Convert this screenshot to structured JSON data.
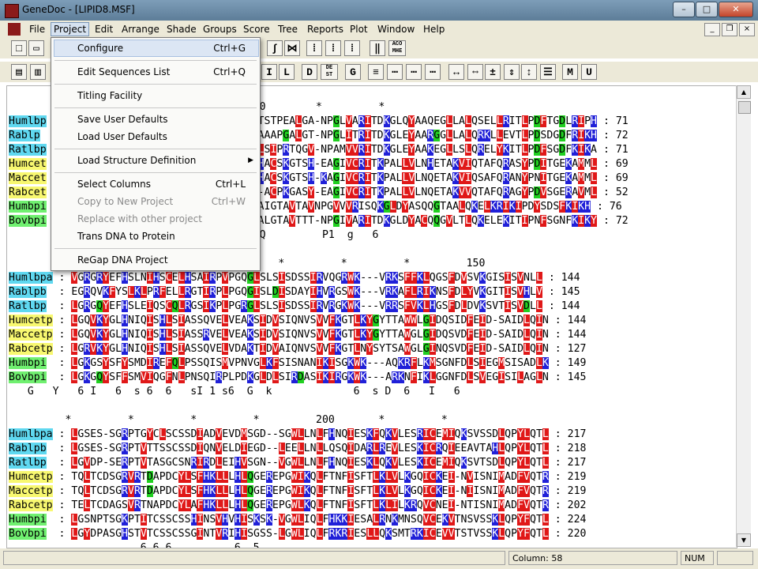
{
  "window": {
    "title": "GeneDoc - [LIPID8.MSF]",
    "min_glyph": "–",
    "max_glyph": "□",
    "close_glyph": "✕"
  },
  "menu": {
    "items": [
      "File",
      "Project",
      "Edit",
      "Arrange",
      "Shade",
      "Groups",
      "Score",
      "Tree",
      "Reports",
      "Plot",
      "Window",
      "Help"
    ],
    "active": "Project"
  },
  "project_menu": {
    "items": [
      {
        "label": "Configure",
        "shortcut": "Ctrl+G",
        "disabled": false,
        "highlighted": true
      },
      {
        "label": "Edit Sequences List",
        "shortcut": "Ctrl+Q",
        "disabled": false
      },
      {
        "label": "Titling Facility",
        "shortcut": "",
        "disabled": false
      },
      {
        "label": "Save User Defaults",
        "shortcut": "",
        "disabled": false
      },
      {
        "label": "Load  User Defaults",
        "shortcut": "",
        "disabled": false
      },
      {
        "label": "Load Structure Definition",
        "shortcut": "",
        "disabled": false,
        "submenu": true
      },
      {
        "label": "Select Columns",
        "shortcut": "Ctrl+L",
        "disabled": false
      },
      {
        "label": "Copy to New Project",
        "shortcut": "Ctrl+W",
        "disabled": true
      },
      {
        "label": "Replace with other project",
        "shortcut": "",
        "disabled": true
      },
      {
        "label": "Trans DNA to Protein",
        "shortcut": "",
        "disabled": false
      },
      {
        "label": "ReGap DNA Project",
        "shortcut": "",
        "disabled": false
      }
    ]
  },
  "toolbar2_labels": [
    "I",
    "L",
    "D",
    "G",
    "M",
    "U"
  ],
  "toolbar2_small": [
    "DE ST"
  ],
  "toolbar1_small": [
    "ACO MHE"
  ],
  "alignment": {
    "block1": {
      "ruler": "                   *         *         50        *         *",
      "rows": [
        {
          "name": "Humlbp",
          "tail": "TSTPEALGA-NPGLVARITDKGLQYAAQEGLLALQSELLRITLPDFTGDLRIPH",
          "pos": "71"
        },
        {
          "name": "Rablp",
          "tail": "AAAPGALGT-NPGLITRITDKGLEYAARGGLLALQRKLLEVTLPDSDGDFRIKH",
          "pos": "72"
        },
        {
          "name": "Ratlbp",
          "tail": "LSIPRTQGV-NPAMVVRITDKGLEYAAKEGLLSLQRELYKITLPDFSGDFKIKA",
          "pos": "71"
        },
        {
          "name": "Humcet",
          "tail": "HACSKGTSH-EAGIVCRITKPALLVLNHETAKVIQTAFQRASYPDITGEKAMML",
          "pos": "69"
        },
        {
          "name": "Maccet",
          "tail": "HACSKGTSH-KAGIVCRITKPALLVLNQETAKVIQSAFQRANYPNITGEKAMML",
          "pos": "69"
        },
        {
          "name": "Rabcet",
          "tail": "-ACPKGASY-EAGIVCRITKPALLVLNQETAKVVQTAFQRAGYPDVSGERAVML",
          "pos": "52"
        },
        {
          "name": "Humbpi",
          "tail": "AIGTAVTAVNPGVVVRISQKGLDYASQQGTAALQKELKRIKIPDYSDSFKIKH",
          "pos": "76"
        },
        {
          "name": "Bovbpi",
          "tail": "ALGTAVTTT-NPGIVARITDKGLDYACQQGVLTLQKELEKITIPNFSGNFKIKY",
          "pos": "72"
        }
      ],
      "consensus": "                   g66 RI3   L    2    6Q         P1  g   6"
    },
    "block2": {
      "ruler": "                      00         *         *         *         *         150",
      "rows": [
        {
          "name": "Humlbpa",
          "seq": "VGRGRYEFHSLNIHSCELHSAIRPVPGQGLSLSISDSSIRVQGRWK---VRKSFFKLQGSFDVSVKGISISVNLL",
          "pos": "144"
        },
        {
          "name": "Rablpb",
          "seq": "EGRQVKFYSLKLPRFELLRGTIRPLPGQGISLDISDAYIHVRGSWK---VRKAFLRIKNSFDLYVKGITISVHLV",
          "pos": "145"
        },
        {
          "name": "Ratlbp",
          "seq": "LGRGQYEFHSLEIQSCQLRGSIKPLPGRGLSLSISDSSIRVRGKWK---VRRSFVKLHGSFDLDVKSVTISVDLL",
          "pos": "144"
        },
        {
          "name": "Humcetp",
          "seq": "LGQVKYGLHNIQISHLSIASSQVELVEAKSIDVSIQNVSVVFKGTLKYGYTTAWWLGIDQSIDFEID-SAIDLQIN",
          "pos": "144"
        },
        {
          "name": "Maccetp",
          "seq": "LGQVKYGLHNIQISHLSIASSRVELVEAKSIDVSIQNVSVVFKGTLKYGYTTAWGLGIDQSVDFEID-SAIDLQIN",
          "pos": "144"
        },
        {
          "name": "Rabcetp",
          "seq": "LGRVKYGLHNIQISHLSIASSQVELVDAKTIDVAIQNVSVVFKGTLNYSYTSAWGLGINQSVDFEID-SAIDLQIN",
          "pos": "127"
        },
        {
          "name": "Humbpi",
          "seq": "LGKGSYSFYSMDIREFQLPSSQISMVPNVGLKFSISNANIKISGKWK---AQKRFLKMSGNFDLSIEGMSISADLK",
          "pos": "149"
        },
        {
          "name": "Bovbpi",
          "seq": "LGKGQYSFFSMVIQGFNLPNSQIRPLPDKGLDLSIRDASIKIRGKWK---ARKNFIKLGGNFDLSVEGISILAGLN",
          "pos": "145"
        }
      ],
      "consensus": "   G   Y   6 I   6  s 6  6   sI 1 s6  G  k             6  s D  6   I   6"
    },
    "block3": {
      "ruler": "         *         *         *         *         200       *         *",
      "rows": [
        {
          "name": "Humlbpa",
          "seq": "LGSES-SGRPTGYCLSCSSDIADVEVDMSGD--SGWLLNLFHNQIESKFQKVLESRICEMIQKSVSSDLQPYLQTL",
          "pos": "217"
        },
        {
          "name": "Rablpb",
          "seq": "LGSES-SGRPTVTTSSCSSDIQNVELDIEGD--LEELLNLLQSQIDARLREVLESKICRQIEEAVTAHLQPYLQTL",
          "pos": "218"
        },
        {
          "name": "Ratlbp",
          "seq": "LGVDP-SERPTVTASGCSNRIRDLEIHVSGN--VGWLLNLFHNQIESKLQKVLESKICEMIQKSVTSDLQPYLQTL",
          "pos": "217"
        },
        {
          "name": "Humcetp",
          "seq": "TQLTCDSGRVRTDAPDCYLSFHKLLLHLQGEREPGWIKQLFTNFISFTLKLVLKGQICKEI-NVISNIMADFVQTR",
          "pos": "219"
        },
        {
          "name": "Maccetp",
          "seq": "TQLTCDSGRVRTDAPDCYLSFHKLLLHLQGEREPGWIKQLFTNFISFTLKLVLKGQICKEI-NIISNIMADFVQTR",
          "pos": "219"
        },
        {
          "name": "Rabcetp",
          "seq": "TELTCDAGSVRTNAPDCYLAFHKLLLHLQGEREPGWLKQLFTNFISFTLKLILKRQVCNEI-NTISNIMADFVQTR",
          "pos": "202"
        },
        {
          "name": "Humbpi",
          "seq": "LGSNPTSGKPTITCSSCSSHINSVHVHISKSK-VGWLIQLFHKKIESALRNKMNSQVCEKVTNSVSSKLQPYFQTL",
          "pos": "224"
        },
        {
          "name": "Bovbpi",
          "seq": "LGYDPASGHSTVTCSSCSSGINTVRIHISGSS-LGWLIQLFRKRIESLLQKSMTRKICEVVTSTVSSKLQPYFQTL",
          "pos": "220"
        }
      ],
      "partial_consensus": "                     6 6 6          6  5"
    }
  },
  "status": {
    "column": "Column: 58",
    "num": "NUM"
  },
  "colors": {
    "blue": "#2020d8",
    "red": "#e01818",
    "green": "#20d020",
    "name_cyan": "#5fd8f0",
    "name_yellow": "#f8f870",
    "name_green": "#70f070"
  }
}
